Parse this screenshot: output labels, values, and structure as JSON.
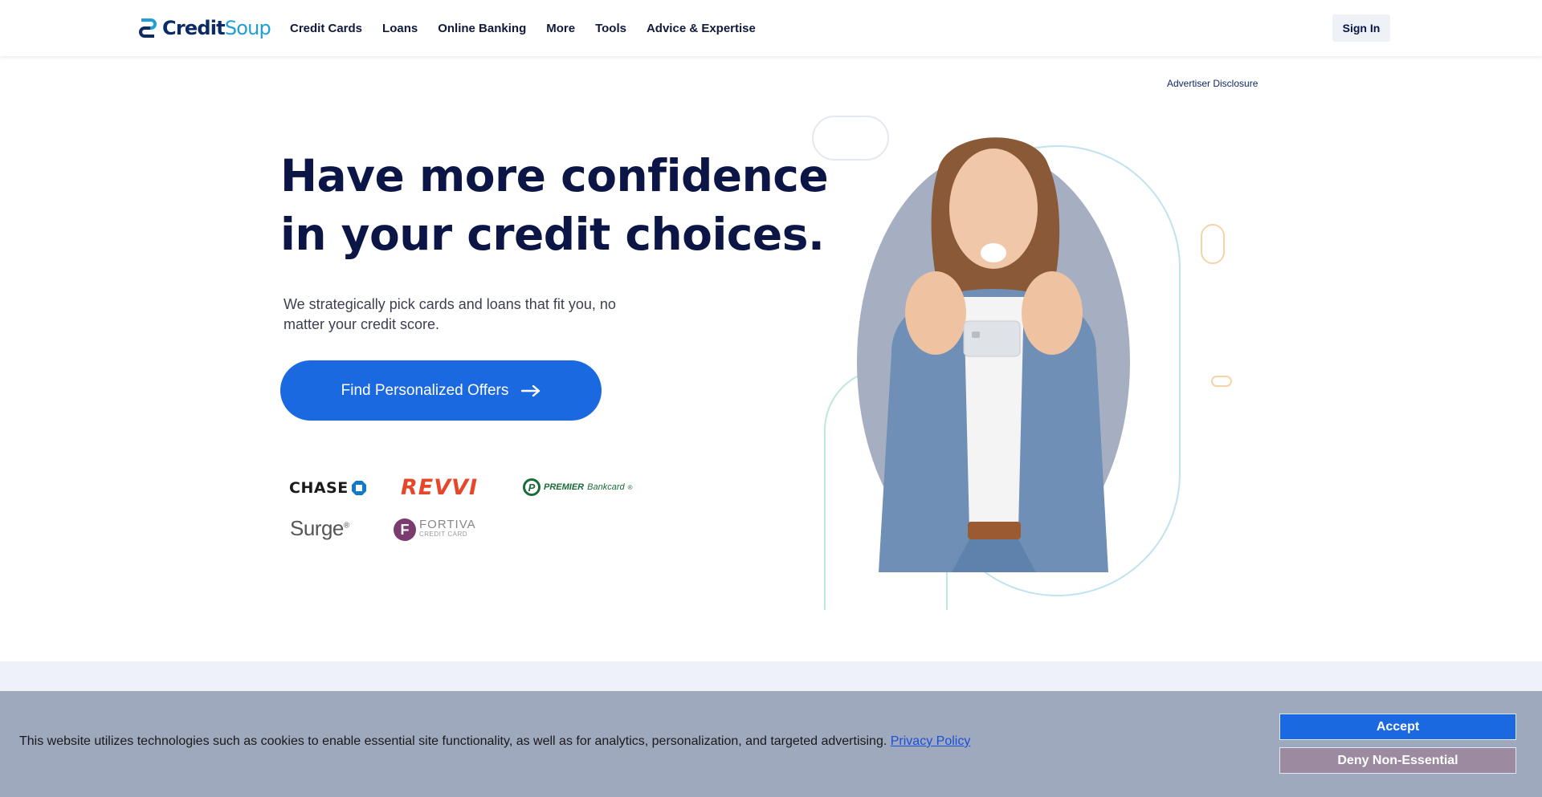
{
  "brand": {
    "logo_part1": "Credit",
    "logo_part2": "Soup"
  },
  "nav": {
    "items": [
      "Credit Cards",
      "Loans",
      "Online Banking",
      "More",
      "Tools",
      "Advice & Expertise"
    ],
    "signin_label": "Sign In"
  },
  "hero": {
    "disclosure": "Advertiser Disclosure",
    "headline_line1": "Have more confidence",
    "headline_line2": "in your credit choices.",
    "subtext": "We strategically pick cards and loans that fit you, no matter your credit score.",
    "cta_label": "Find Personalized Offers",
    "cta_icon": "arrow-right-icon"
  },
  "partners": {
    "chase": "CHASE",
    "revvi": "REVVI",
    "premier_bold": "PREMIER",
    "premier_light": "Bankcard",
    "premier_reg": "®",
    "surge": "Surge",
    "surge_reg": "®",
    "fortiva": "FORTIVA",
    "fortiva_sub": "CREDIT CARD"
  },
  "cookie": {
    "text": "This website utilizes technologies such as cookies to enable essential site functionality, as well as for analytics, personalization, and targeted advertising.",
    "link": "Privacy Policy",
    "accept_label": "Accept",
    "deny_label": "Deny Non-Essential"
  },
  "colors": {
    "navy": "#0b1646",
    "cta_blue": "#1b69e0",
    "cookie_bg": "#9ea9be",
    "deny_bg": "#9c8ba0"
  }
}
